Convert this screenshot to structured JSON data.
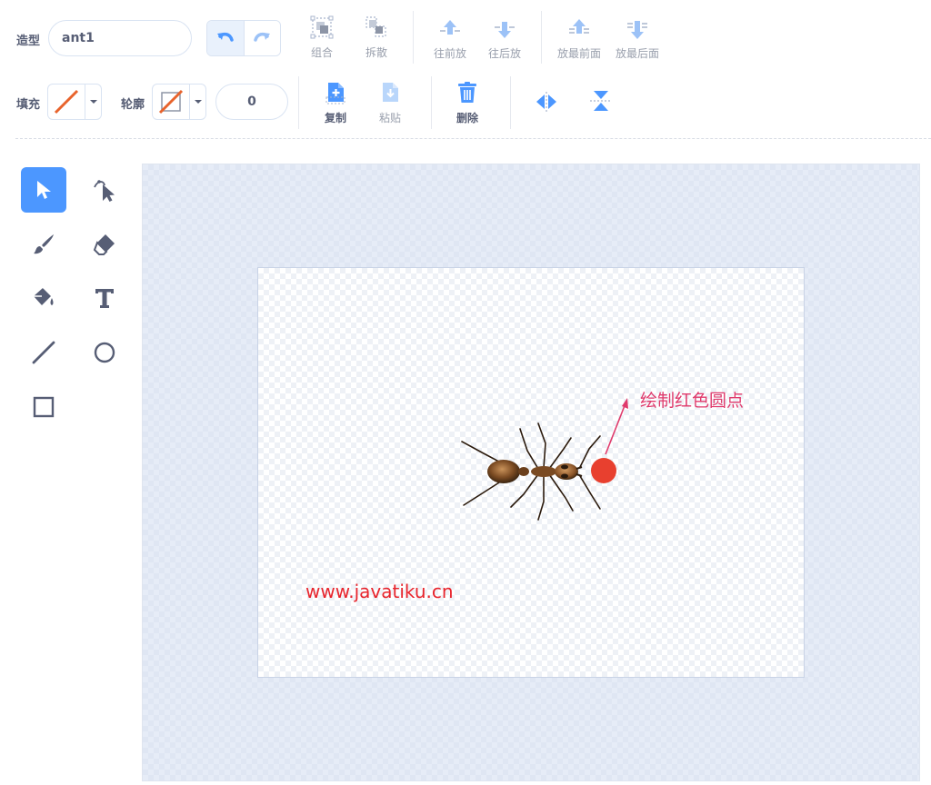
{
  "toolbar": {
    "costume_label": "造型",
    "costume_name": "ant1",
    "group_label": "组合",
    "ungroup_label": "拆散",
    "forward_label": "往前放",
    "backward_label": "往后放",
    "front_label": "放最前面",
    "back_label": "放最后面",
    "fill_label": "填充",
    "outline_label": "轮廓",
    "outline_width": "0",
    "copy_label": "复制",
    "paste_label": "粘贴",
    "delete_label": "删除"
  },
  "canvas": {
    "annotation": "绘制红色圆点",
    "watermark": "www.javatiku.cn"
  },
  "colors": {
    "accent": "#4c97ff",
    "red_dot": "#e8402f",
    "annotation": "#e03a6c",
    "watermark": "#e8242c"
  },
  "icons": [
    "undo-icon",
    "redo-icon",
    "group-icon",
    "ungroup-icon",
    "forward-icon",
    "backward-icon",
    "front-icon",
    "back-icon",
    "copy-icon",
    "paste-icon",
    "delete-icon",
    "flip-horizontal-icon",
    "flip-vertical-icon",
    "select-icon",
    "reshape-icon",
    "brush-icon",
    "eraser-icon",
    "fill-icon",
    "text-icon",
    "line-icon",
    "circle-icon",
    "rectangle-icon"
  ]
}
